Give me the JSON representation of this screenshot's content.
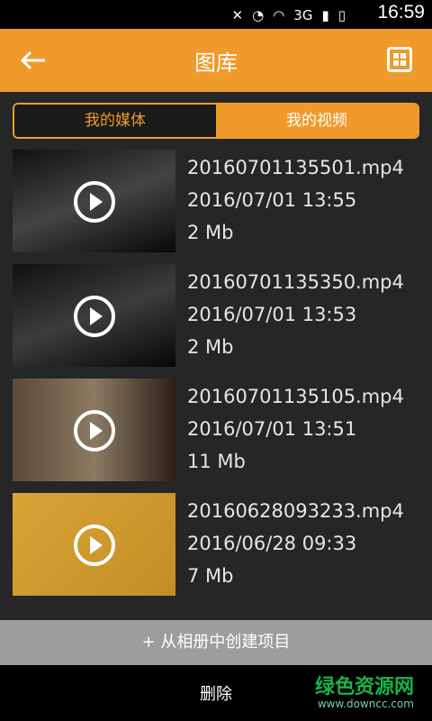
{
  "status": {
    "time": "16:59",
    "network": "3G",
    "icons": [
      "mute-icon",
      "alarm-icon",
      "wifi-icon",
      "signal-icon",
      "battery-icon"
    ]
  },
  "appbar": {
    "title": "图库",
    "back_icon": "back-arrow-icon",
    "grid_icon": "grid-view-icon"
  },
  "tabs": [
    {
      "label": "我的媒体",
      "active": false
    },
    {
      "label": "我的视频",
      "active": true
    }
  ],
  "videos": [
    {
      "name": "20160701135501.mp4",
      "date": "2016/07/01 13:55",
      "size": "2 Mb"
    },
    {
      "name": "20160701135350.mp4",
      "date": "2016/07/01 13:53",
      "size": "2 Mb"
    },
    {
      "name": "20160701135105.mp4",
      "date": "2016/07/01 13:51",
      "size": "11 Mb"
    },
    {
      "name": "20160628093233.mp4",
      "date": "2016/06/28 09:33",
      "size": "7 Mb"
    }
  ],
  "bottom_action": "+ 从相册中创建项目",
  "footer": {
    "delete_label": "删除",
    "watermark_main": "绿色资源网",
    "watermark_sub": "www.downcc.com"
  },
  "colors": {
    "accent": "#ef9a2a",
    "background": "#262626",
    "bottom_bar": "#9d9d9d"
  }
}
